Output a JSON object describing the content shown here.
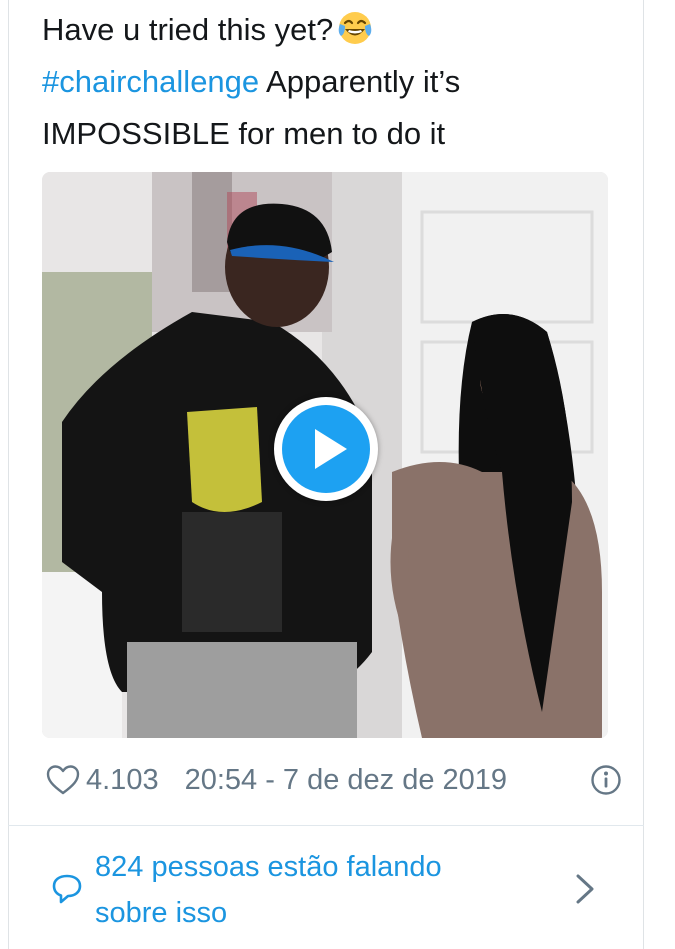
{
  "tweet": {
    "text_line1": "Have u tried this yet?",
    "emoji": "face-with-tears-of-joy",
    "hashtag": "#chairchallenge",
    "text_line2_rest": " Apparently it’s",
    "text_line3": "IMPOSSIBLE for men to do it"
  },
  "video": {
    "play_icon": "play-icon"
  },
  "meta": {
    "like_icon": "heart-icon",
    "likes": "4.103",
    "timestamp": "20:54 - 7 de dez de 2019",
    "info_icon": "info-icon"
  },
  "conversation": {
    "icon": "comment-icon",
    "line1": "824 pessoas estão falando",
    "line2": "sobre isso",
    "chevron_icon": "chevron-right-icon"
  },
  "colors": {
    "link": "#1b95e0",
    "play_button": "#1da1f2",
    "secondary_text": "#657786",
    "primary_text": "#14171a"
  }
}
